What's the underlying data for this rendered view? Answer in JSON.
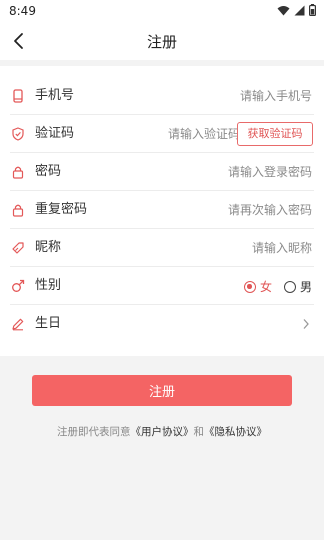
{
  "status_bar": {
    "time": "8:49"
  },
  "nav": {
    "title": "注册"
  },
  "form": {
    "phone": {
      "label": "手机号",
      "placeholder": "请输入手机号"
    },
    "code": {
      "label": "验证码",
      "placeholder": "请输入验证码",
      "button": "获取验证码"
    },
    "password": {
      "label": "密码",
      "placeholder": "请输入登录密码"
    },
    "confirm_password": {
      "label": "重复密码",
      "placeholder": "请再次输入密码"
    },
    "nickname": {
      "label": "昵称",
      "placeholder": "请输入昵称"
    },
    "gender": {
      "label": "性别",
      "options": [
        "女",
        "男"
      ],
      "selected": "女"
    },
    "birthday": {
      "label": "生日"
    }
  },
  "register_button": "注册",
  "agreement": {
    "prefix": "注册即代表同意",
    "user_agreement": "《用户协议》",
    "connector": "和",
    "privacy_policy": "《隐私协议》"
  },
  "colors": {
    "accent": "#f46464",
    "accent_text": "#e05555",
    "background": "#f3f3f3"
  },
  "icons": {
    "back": "back-arrow-icon",
    "phone": "phone-icon",
    "code": "shield-icon",
    "password": "lock-icon",
    "confirm_password": "lock-icon",
    "nickname": "tag-icon",
    "gender": "male-symbol-icon",
    "birthday": "pencil-icon",
    "chevron": "chevron-right-icon"
  }
}
